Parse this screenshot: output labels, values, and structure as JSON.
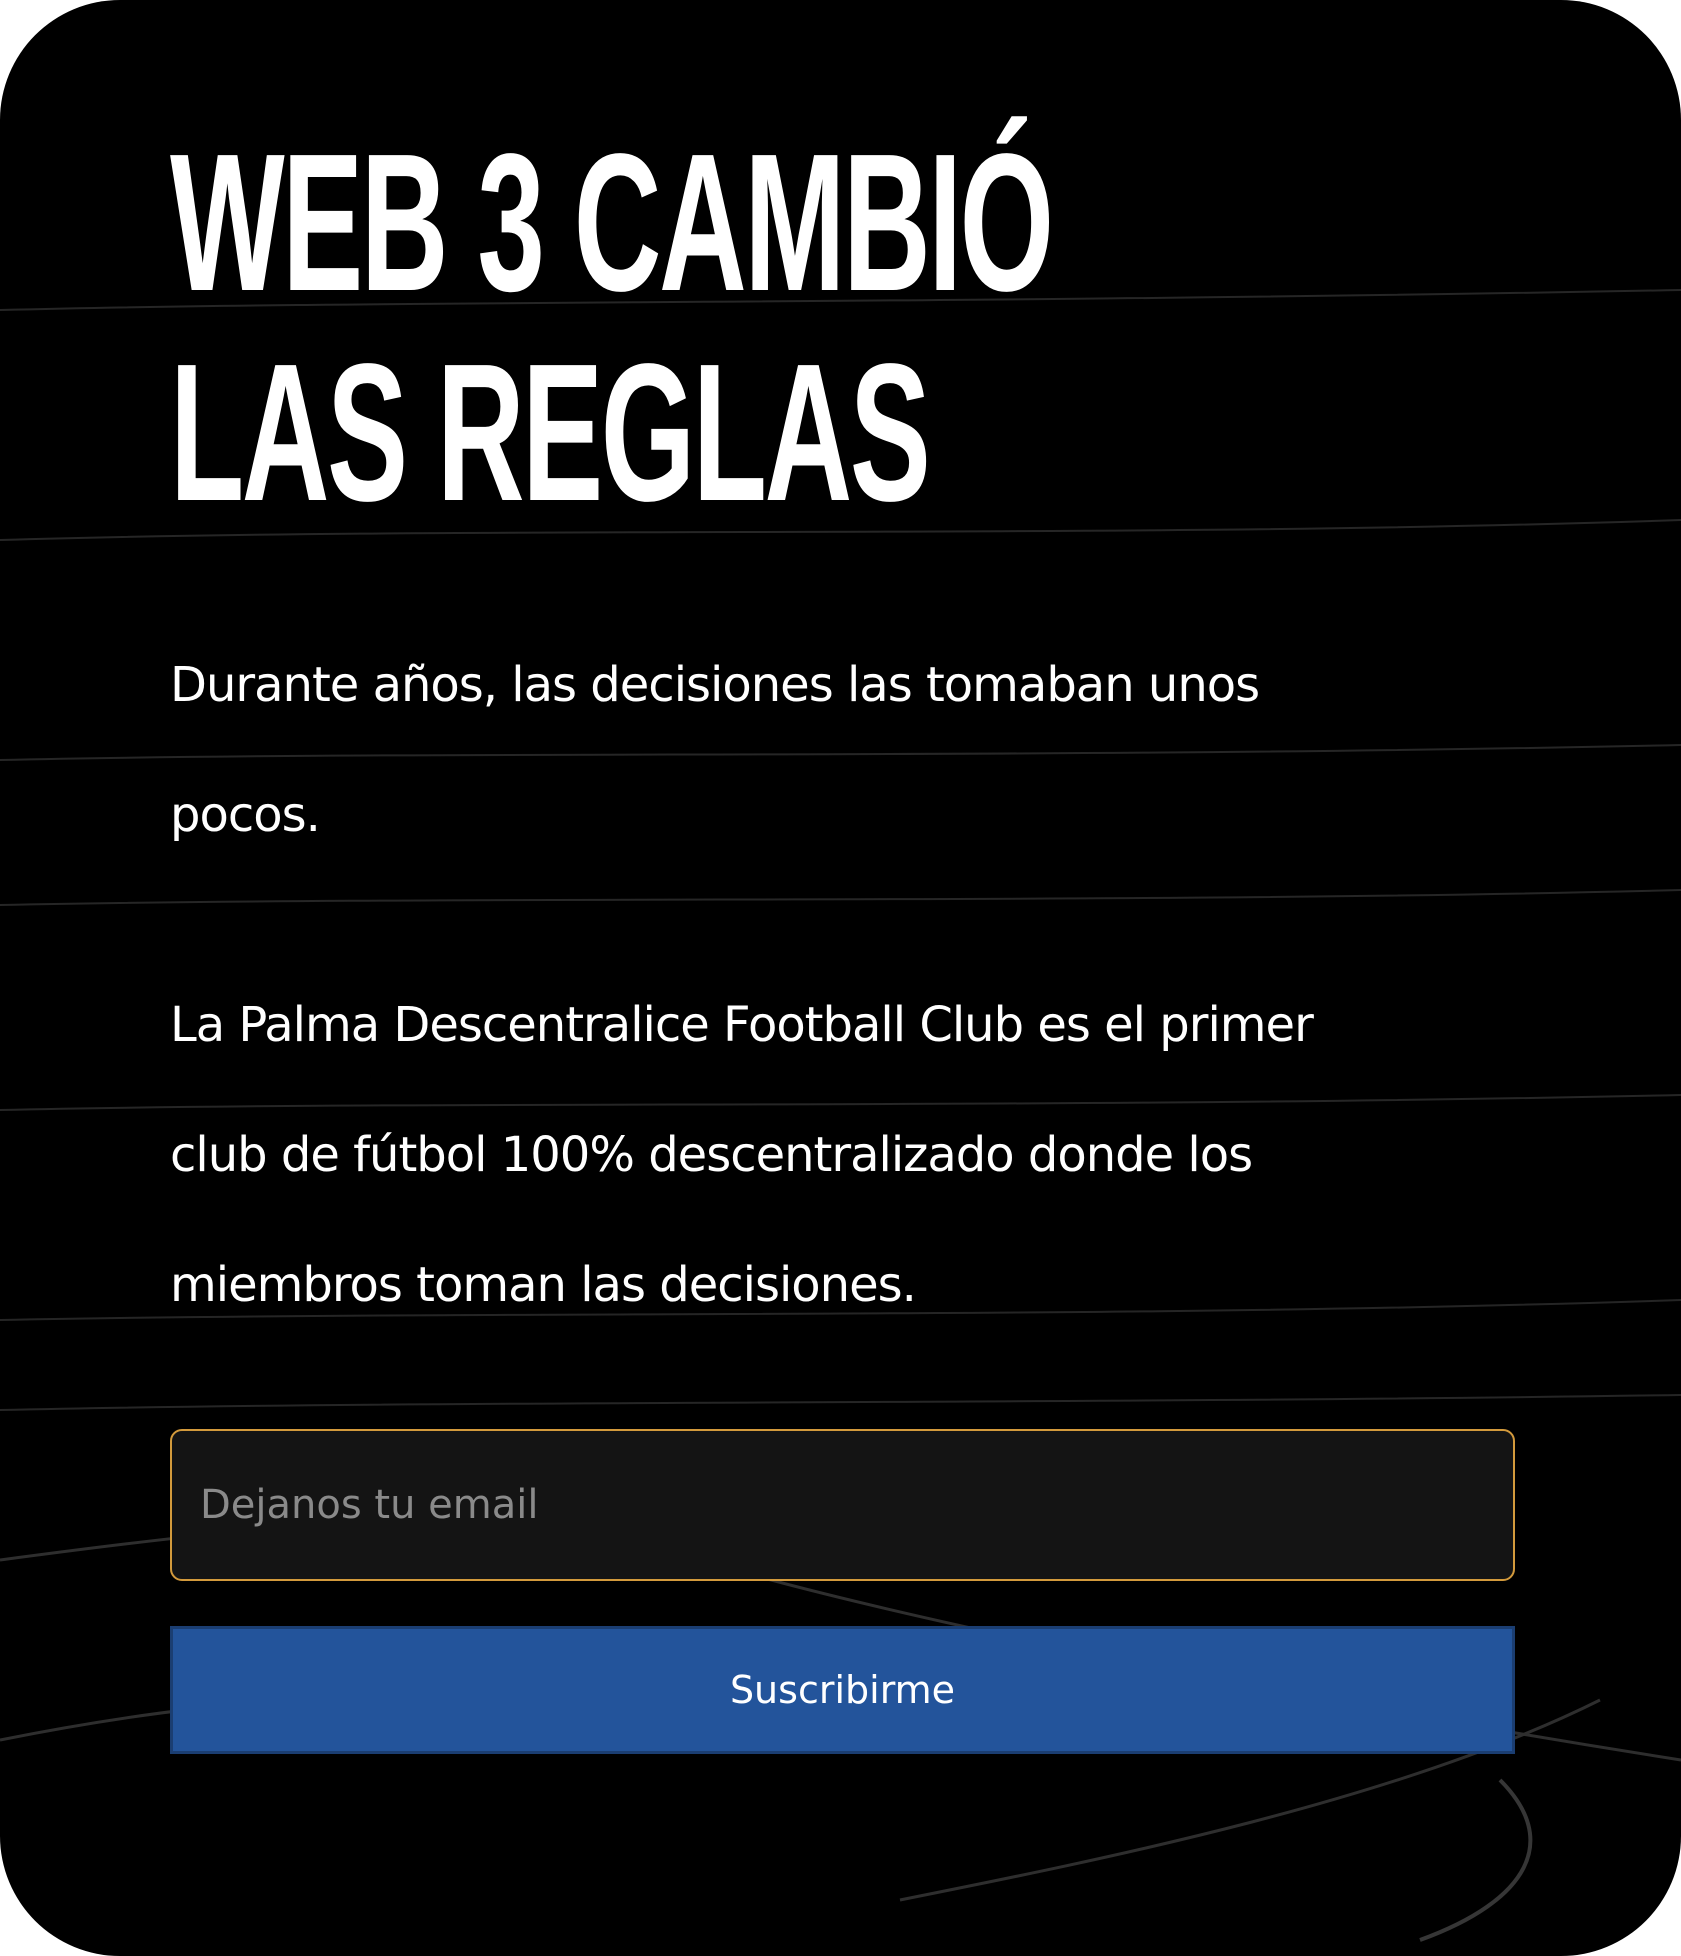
{
  "hero": {
    "title_line_1": "WEB 3 CAMBIÓ",
    "title_line_2": "LAS REGLAS"
  },
  "intro": {
    "paragraph_1_lines": [
      "Durante años, las decisiones las tomaban unos",
      "pocos."
    ],
    "paragraph_2_lines": [
      "La Palma Descentralice Football Club es el primer",
      "club de fútbol 100% descentralizado donde los",
      "miembros toman las decisiones."
    ]
  },
  "form": {
    "email_placeholder": "Dejanos tu email",
    "email_value": "",
    "submit_label": "Suscribirme"
  },
  "colors": {
    "background": "#000000",
    "text": "#ffffff",
    "input_border": "#d39a3c",
    "input_background": "#141414",
    "button_background": "#23549b",
    "button_border": "#1b3e72"
  }
}
